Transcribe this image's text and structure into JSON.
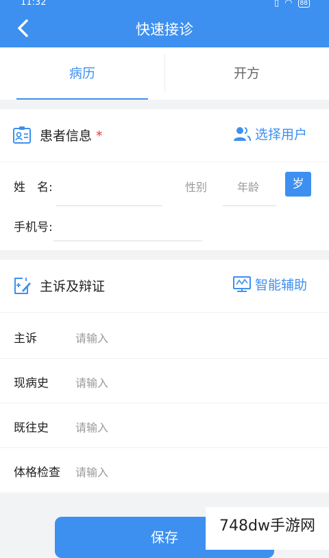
{
  "status": {
    "time": "11:32",
    "battery": "88"
  },
  "nav": {
    "title": "快速接诊"
  },
  "tabs": [
    {
      "label": "病历"
    },
    {
      "label": "开方"
    }
  ],
  "patient": {
    "title": "患者信息",
    "required": "*",
    "action": "选择用户",
    "name_label": "姓　名:",
    "gender_placeholder": "性别",
    "age_placeholder": "年龄",
    "age_unit": "岁",
    "phone_label": "手机号:"
  },
  "complaint": {
    "title": "主诉及辩证",
    "action": "智能辅助",
    "rows": [
      {
        "label": "主诉",
        "placeholder": "请输入"
      },
      {
        "label": "现病史",
        "placeholder": "请输入"
      },
      {
        "label": "既往史",
        "placeholder": "请输入"
      },
      {
        "label": "体格检查",
        "placeholder": "请输入"
      }
    ]
  },
  "footer": {
    "save": "保存",
    "watermark": "748dw手游网"
  },
  "colors": {
    "primary": "#3d90f0",
    "required": "#e23b3b"
  },
  "icons": [
    "wifi-icon",
    "signal-icon",
    "back-chevron-icon",
    "id-card-icon",
    "users-icon",
    "edit-note-icon",
    "monitor-icon"
  ]
}
